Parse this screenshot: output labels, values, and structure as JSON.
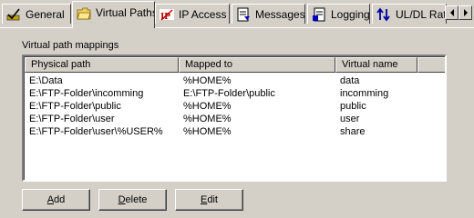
{
  "tabs": [
    {
      "label": "General",
      "icon": "checkmark-chart-icon",
      "active": false
    },
    {
      "label": "Virtual Paths",
      "icon": "folder-icon",
      "active": true
    },
    {
      "label": "IP Access",
      "icon": "ip-access-icon",
      "active": false
    },
    {
      "label": "Messages",
      "icon": "messages-icon",
      "active": false
    },
    {
      "label": "Logging",
      "icon": "logging-icon",
      "active": false
    },
    {
      "label": "UL/DL Ratios",
      "icon": "ratio-arrows-icon",
      "active": false
    }
  ],
  "group_label": "Virtual path mappings",
  "list": {
    "columns": [
      "Physical path",
      "Mapped to",
      "Virtual name"
    ],
    "rows": [
      [
        "E:\\Data",
        "%HOME%",
        "data"
      ],
      [
        "E:\\FTP-Folder\\incomming",
        "E:\\FTP-Folder\\public",
        "incomming"
      ],
      [
        "E:\\FTP-Folder\\public",
        "%HOME%",
        "public"
      ],
      [
        "E:\\FTP-Folder\\user",
        "%HOME%",
        "user"
      ],
      [
        "E:\\FTP-Folder\\user\\%USER%",
        "%HOME%",
        "share"
      ]
    ]
  },
  "buttons": {
    "add": {
      "mnemonic": "A",
      "rest": "dd"
    },
    "delete": {
      "mnemonic": "D",
      "rest": "elete"
    },
    "edit": {
      "mnemonic": "E",
      "rest": "dit"
    }
  },
  "colors": {
    "face": "#d4d0c8",
    "highlight": "#ffffff",
    "shadow": "#808080",
    "dark_shadow": "#404040"
  }
}
